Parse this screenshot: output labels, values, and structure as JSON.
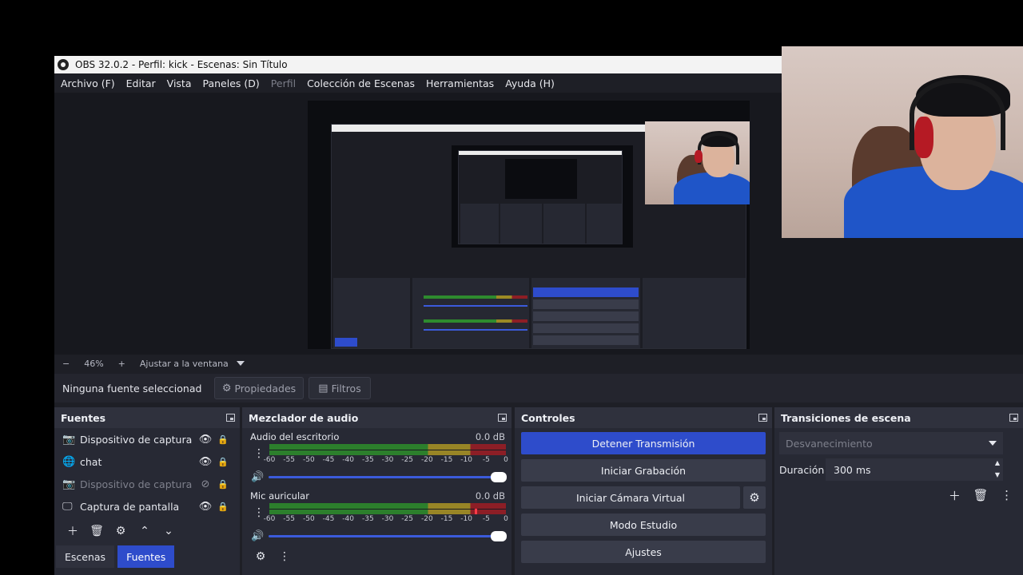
{
  "window": {
    "title": "OBS 32.0.2 - Perfil: kick - Escenas: Sin Título"
  },
  "menu": {
    "file": "Archivo (F)",
    "edit": "Editar",
    "view": "Vista",
    "docks": "Paneles (D)",
    "profile": "Perfil",
    "scene_collection": "Colección de Escenas",
    "tools": "Herramientas",
    "help": "Ayuda (H)"
  },
  "zoom": {
    "minus": "−",
    "value": "46%",
    "plus": "+",
    "fit": "Ajustar a la ventana"
  },
  "source_toolbar": {
    "no_selection": "Ninguna fuente seleccionad",
    "properties": "Propiedades",
    "filters": "Filtros"
  },
  "sources_dock": {
    "title": "Fuentes",
    "items": [
      {
        "name": "Dispositivo de captura de",
        "icon": "camera-icon",
        "visible": true,
        "locked": false
      },
      {
        "name": "chat",
        "icon": "globe-icon",
        "visible": true,
        "locked": false
      },
      {
        "name": "Dispositivo de captura de",
        "icon": "camera-icon",
        "visible": false,
        "locked": true
      },
      {
        "name": "Captura de pantalla",
        "icon": "monitor-icon",
        "visible": true,
        "locked": false
      }
    ],
    "tabs": {
      "scenes": "Escenas",
      "sources": "Fuentes"
    }
  },
  "mixer_dock": {
    "title": "Mezclador de audio",
    "ticks": [
      "-60",
      "-55",
      "-50",
      "-45",
      "-40",
      "-35",
      "-30",
      "-25",
      "-20",
      "-15",
      "-10",
      "-5",
      "0"
    ],
    "channels": [
      {
        "name": "Audio del escritorio",
        "db": "0.0 dB",
        "peak_db": null,
        "volume": 1.0
      },
      {
        "name": "Mic auricular",
        "db": "0.0 dB",
        "peak_db": -8,
        "volume": 1.0
      }
    ]
  },
  "controls_dock": {
    "title": "Controles",
    "stop_stream": "Detener Transmisión",
    "start_recording": "Iniciar Grabación",
    "start_virtual_cam": "Iniciar Cámara Virtual",
    "studio_mode": "Modo Estudio",
    "settings": "Ajustes"
  },
  "transitions_dock": {
    "title": "Transiciones de escena",
    "selected": "Desvanecimiento",
    "duration_label": "Duración",
    "duration_value": "300 ms"
  },
  "colors": {
    "accent": "#2e4ccb",
    "panel": "#272934",
    "background": "#1e1f26",
    "meter_green": "#2c7f2c",
    "meter_yellow": "#988526",
    "meter_red": "#8c1e26"
  }
}
